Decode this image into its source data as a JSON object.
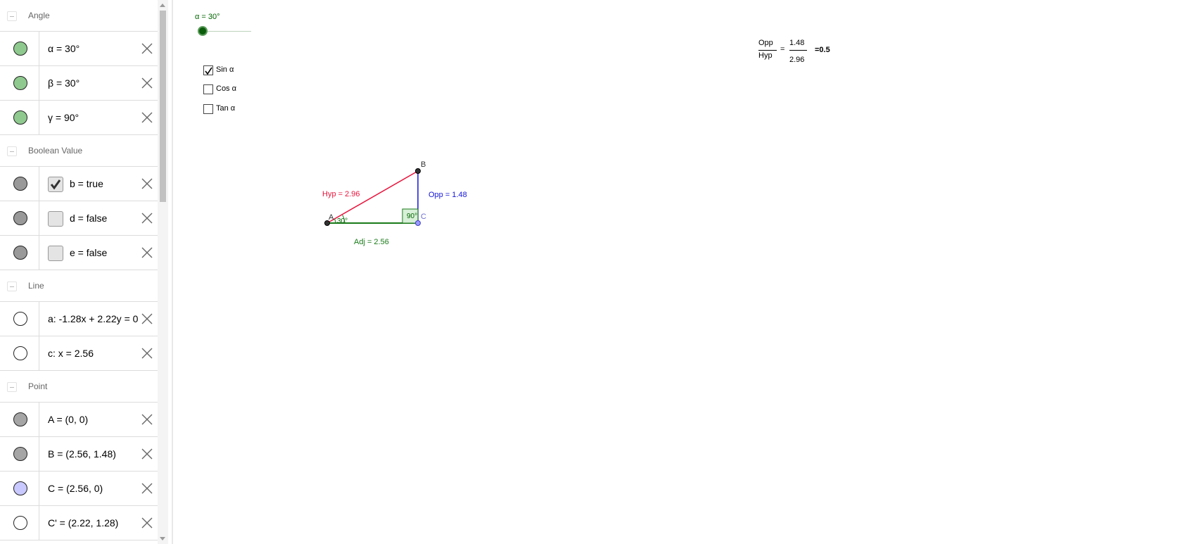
{
  "algebra": {
    "groups": [
      {
        "name": "Angle",
        "items": [
          {
            "text": "α = 30°",
            "marble": "#8fc98f"
          },
          {
            "text": "β = 30°",
            "marble": "#8fc98f"
          },
          {
            "text": "γ = 90°",
            "marble": "#8fc98f"
          }
        ]
      },
      {
        "name": "Boolean Value",
        "items": [
          {
            "text": "b = true",
            "checked": true,
            "marble": "#999999"
          },
          {
            "text": "d = false",
            "checked": false,
            "marble": "#999999"
          },
          {
            "text": "e = false",
            "checked": false,
            "marble": "#999999"
          }
        ]
      },
      {
        "name": "Line",
        "items": [
          {
            "text": "a: -1.28x + 2.22y = 0",
            "marble": "#ffffff"
          },
          {
            "text": "c: x = 2.56",
            "marble": "#ffffff"
          }
        ]
      },
      {
        "name": "Point",
        "items": [
          {
            "text": "A = (0, 0)",
            "marble": "#a5a5a5"
          },
          {
            "text": "B = (2.56, 1.48)",
            "marble": "#a5a5a5"
          },
          {
            "text": "C = (2.56, 0)",
            "marble": "#c9c9ff"
          },
          {
            "text": "C' = (2.22, 1.28)",
            "marble": "#ffffff"
          }
        ]
      }
    ]
  },
  "graphics": {
    "slider": {
      "label": "α = 30°",
      "value_deg": 30
    },
    "checkboxes": [
      {
        "label": "Sin α",
        "checked": true
      },
      {
        "label": "Cos α",
        "checked": false
      },
      {
        "label": "Tan α",
        "checked": false
      }
    ],
    "ratio": {
      "num_label": "Opp",
      "den_label": "Hyp",
      "equals": "=",
      "num_value": "1.48",
      "den_value": "2.96",
      "result": "=0.5"
    },
    "triangle": {
      "point_A": "A",
      "point_B": "B",
      "point_C": "C",
      "hyp_label": "Hyp = 2.96",
      "opp_label": "Opp = 1.48",
      "adj_label": "Adj = 2.56",
      "angle_A_label": "30°",
      "angle_C_label": "90°"
    },
    "colors": {
      "hyp": "#e8143c",
      "opp": "#1414d8",
      "adj": "#1a7a1a",
      "angle": "#006400"
    }
  }
}
